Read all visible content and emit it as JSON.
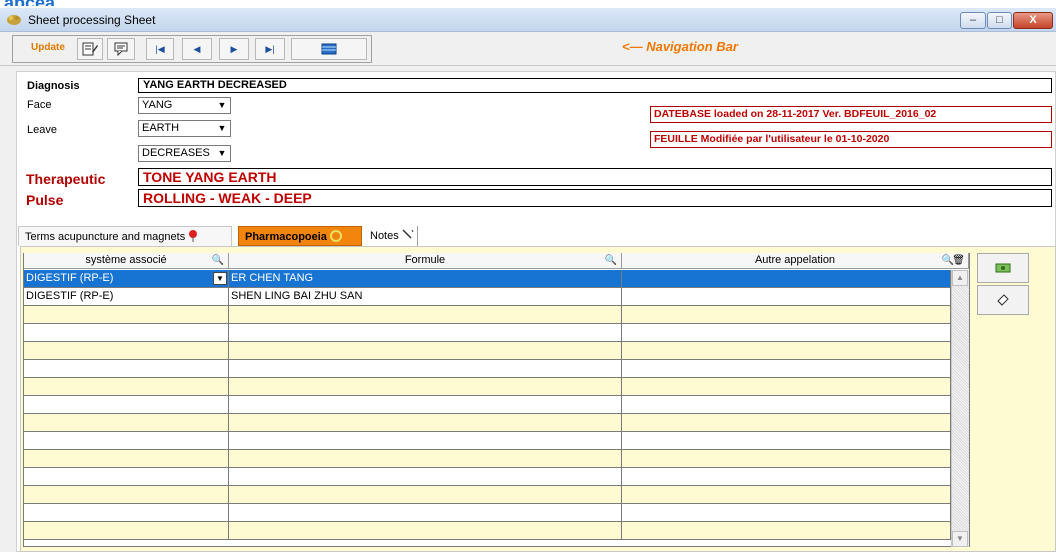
{
  "top_clip_text": "apcea",
  "window": {
    "title": "Sheet processing Sheet",
    "min_label": "–",
    "max_label": "□",
    "close_label": "X"
  },
  "toolbar": {
    "update_label": "Update",
    "nav_first": "|◀",
    "nav_prev": "◀",
    "nav_next": "▶",
    "nav_last": "▶|",
    "navigation_label": "<— Navigation Bar"
  },
  "form": {
    "diagnosis_label": "Diagnosis",
    "diagnosis_value": "YANG EARTH DECREASED",
    "face_label": "Face",
    "face_value": "YANG",
    "leave_label": "Leave",
    "leave_value": "EARTH",
    "third_value": "DECREASES",
    "therapeutic_label": "Therapeutic",
    "therapeutic_value": "TONE YANG EARTH",
    "pulse_label": "Pulse",
    "pulse_value": "ROLLING - WEAK - DEEP",
    "database_info": "DATEBASE loaded on 28-11-2017 Ver. BDFEUIL_2016_02",
    "feuille_info": "FEUILLE Modifiée par l'utilisateur le 01-10-2020"
  },
  "tabs": [
    {
      "label": "Terms acupuncture and magnets",
      "active": false
    },
    {
      "label": "Pharmacopoeia",
      "active": true
    },
    {
      "label": "Notes",
      "active": false
    }
  ],
  "grid": {
    "columns": [
      "système associé",
      "Formule",
      "Autre appelation"
    ],
    "rows": [
      [
        "DIGESTIF (RP-E)",
        "ER CHEN TANG",
        ""
      ],
      [
        "DIGESTIF (RP-E)",
        "SHEN LING BAI ZHU SAN",
        ""
      ]
    ],
    "selected_row": 0,
    "empty_rows": 13
  },
  "colors": {
    "accent_orange": "#f3850e",
    "selection_blue": "#1874d3",
    "label_red": "#b00000",
    "panel_yellow": "#fefbd3"
  }
}
